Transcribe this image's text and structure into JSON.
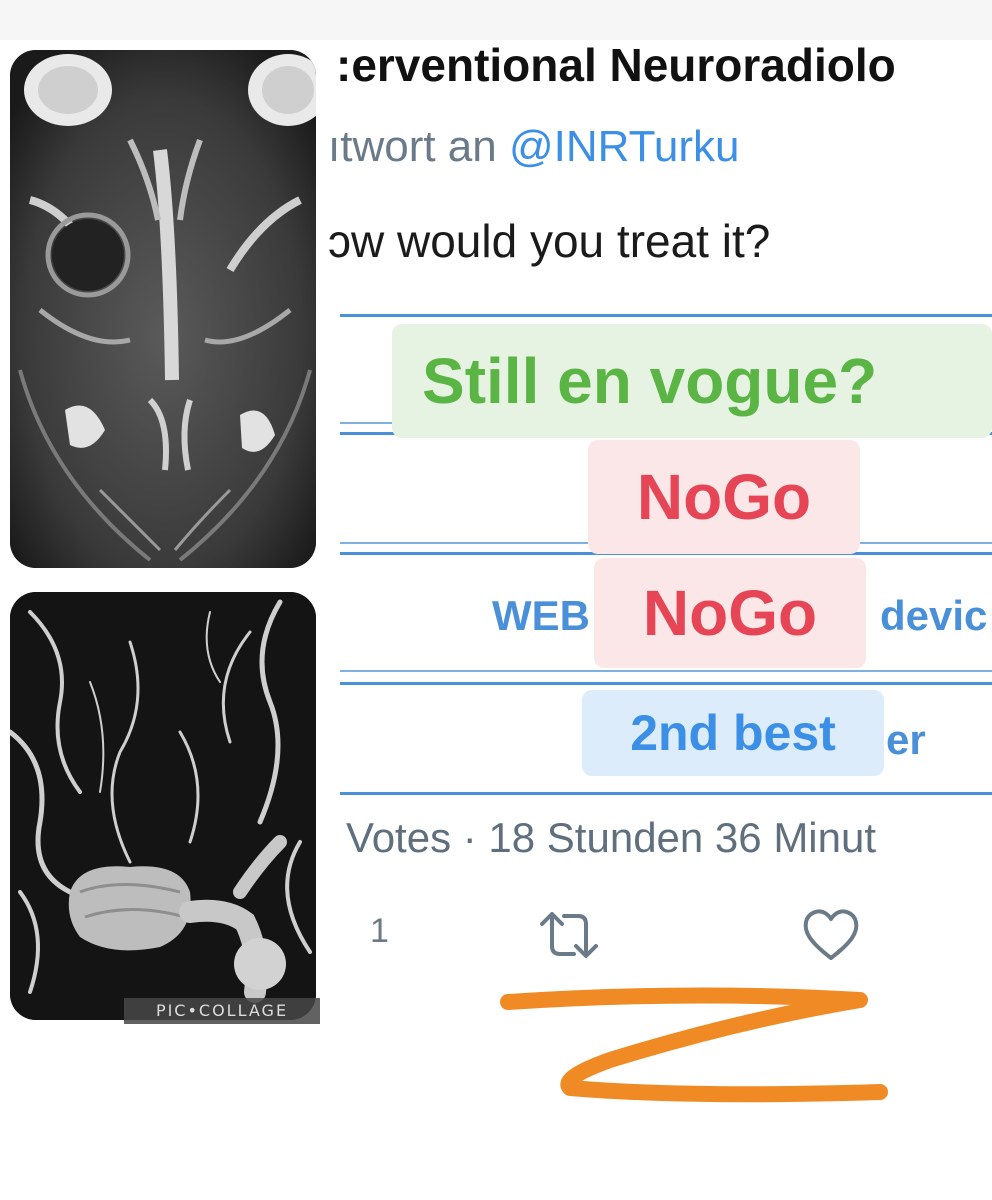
{
  "tweet": {
    "author_name": ":erventional Neuroradiolo",
    "reply_prefix": "ıtwort an ",
    "reply_handle": "@INRTurku",
    "question": "ɔw would you treat it?"
  },
  "poll": {
    "option_left_fragment": "WEB",
    "option_right_fragment": "devic",
    "option_bottom_fragment": "er"
  },
  "stickers": {
    "still_en_vogue": "Still en vogue?",
    "nogo_1": "NoGo",
    "nogo_2": "NoGo",
    "second_best": "2nd best"
  },
  "status": {
    "votes_line": "Votes · 18 Stunden 36 Minut"
  },
  "actions": {
    "reply_count": "1",
    "retweet_icon": "retweet-icon",
    "like_icon": "heart-icon"
  },
  "images": {
    "mri_icon": "brain-mri-image",
    "angio_icon": "cerebral-angiogram-image",
    "watermark": "PIC•COLLAGE"
  },
  "colors": {
    "green_sticker": "#5bb544",
    "red_sticker": "#e64555",
    "blue_sticker": "#3b8fe6",
    "rule_blue": "#4a90d9",
    "scribble_orange": "#f08a24"
  }
}
